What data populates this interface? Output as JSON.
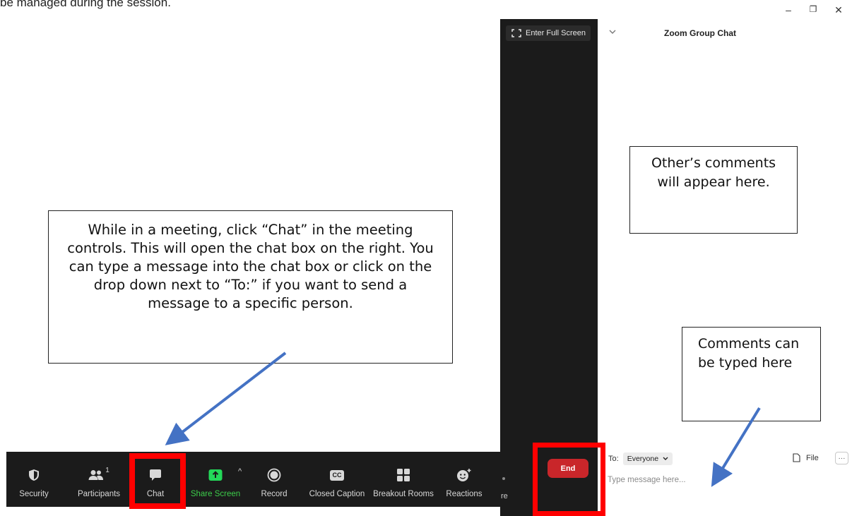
{
  "doc": {
    "top_text": "be managed during the session."
  },
  "window_controls": {
    "minimize": "–",
    "maximize": "❐",
    "close": "✕"
  },
  "callouts": {
    "main": "While in a meeting, click “Chat” in the meeting controls. This will open the chat box on the right. You can type a message into the chat box or click on the drop down next to “To:” if you want to send a message to a specific person.",
    "other_comments": "Other’s comments will appear here.",
    "comments_typed": "Comments can be typed here"
  },
  "toolbar": {
    "items": [
      {
        "label": "Security",
        "icon": "shield-icon"
      },
      {
        "label": "Participants",
        "icon": "participants-icon",
        "count": "1"
      },
      {
        "label": "Chat",
        "icon": "chat-icon"
      },
      {
        "label": "Share Screen",
        "icon": "share-screen-icon"
      },
      {
        "label": "Record",
        "icon": "record-icon"
      },
      {
        "label": "Closed Caption",
        "icon": "closed-caption-icon",
        "badge": "CC"
      },
      {
        "label": "Breakout Rooms",
        "icon": "breakout-rooms-icon"
      },
      {
        "label": "Reactions",
        "icon": "reactions-icon"
      }
    ],
    "share_caret": "^",
    "share_color": "#23d959"
  },
  "side_panel": {
    "fullscreen_label": "Enter Full Screen",
    "end_label": "End",
    "end_color": "#c9262a",
    "partial_label": "re"
  },
  "chat": {
    "title": "Zoom Group Chat",
    "to_label": "To:",
    "to_value": "Everyone",
    "file_label": "File",
    "more_label": "···",
    "placeholder": "Type message here..."
  },
  "colors": {
    "highlight": "#ff0000",
    "arrow": "#4472c4",
    "toolbar_bg": "#1b1b1b"
  }
}
